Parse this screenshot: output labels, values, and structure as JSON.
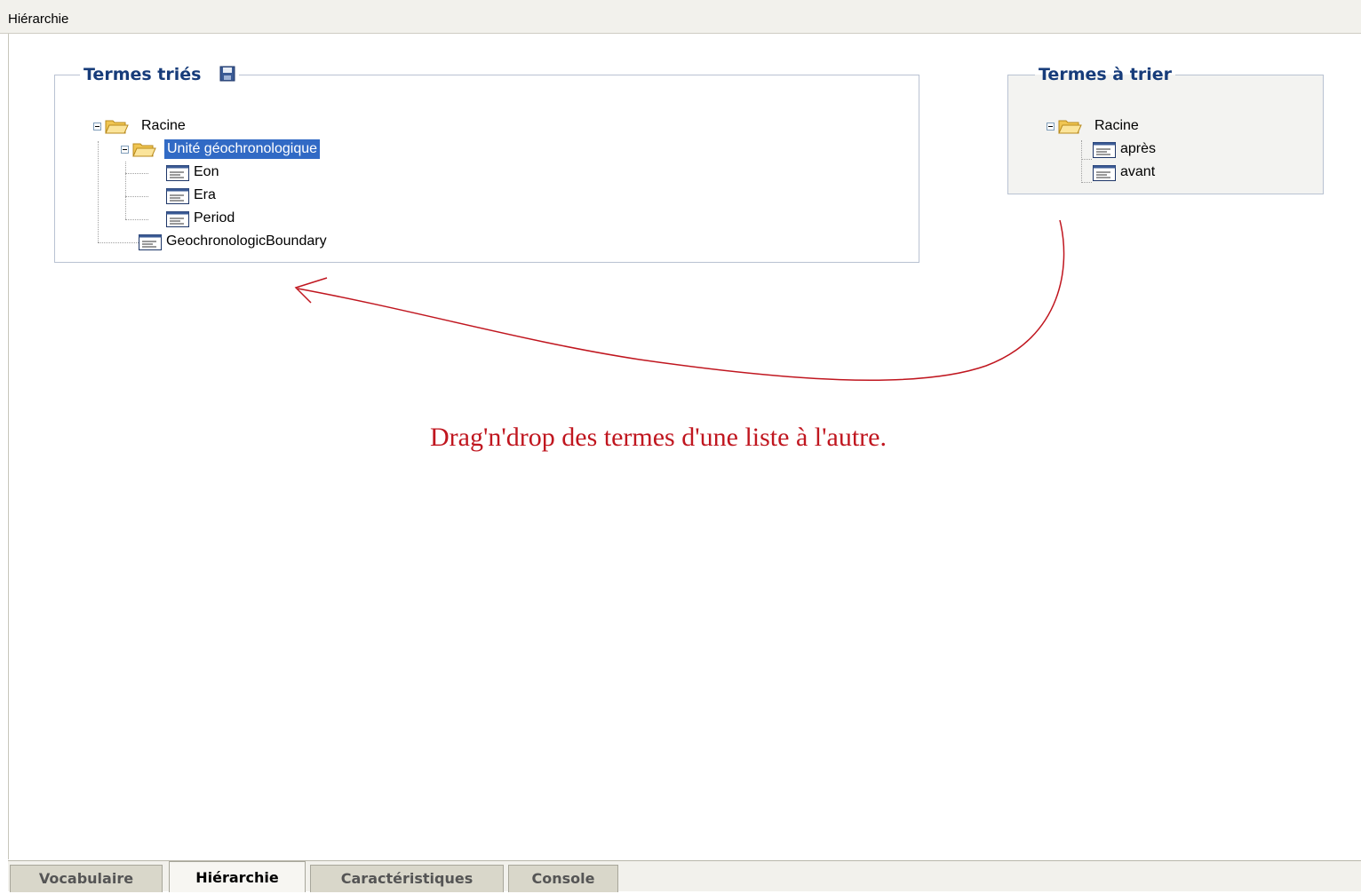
{
  "window": {
    "title": "Hiérarchie"
  },
  "sorted_panel": {
    "title": "Termes triés",
    "save_icon": "save-disk-icon",
    "tree": {
      "root": "Racine",
      "group": "Unité géochronologique",
      "children": [
        "Eon",
        "Era",
        "Period"
      ],
      "sibling": "GeochronologicBoundary",
      "selected": "Unité géochronologique"
    }
  },
  "unsorted_panel": {
    "title": "Termes à trier",
    "tree": {
      "root": "Racine",
      "children": [
        "après",
        "avant"
      ]
    }
  },
  "annotation": {
    "text": "Drag'n'drop des termes d'une liste à l'autre.",
    "color": "#c0161f"
  },
  "tabs": [
    {
      "label": "Vocabulaire",
      "active": false
    },
    {
      "label": "Hiérarchie",
      "active": true
    },
    {
      "label": "Caractéristiques",
      "active": false
    },
    {
      "label": "Console",
      "active": false
    }
  ],
  "colors": {
    "selection": "#316ac5",
    "legend": "#173c7a",
    "folder": "#f5d36a"
  }
}
